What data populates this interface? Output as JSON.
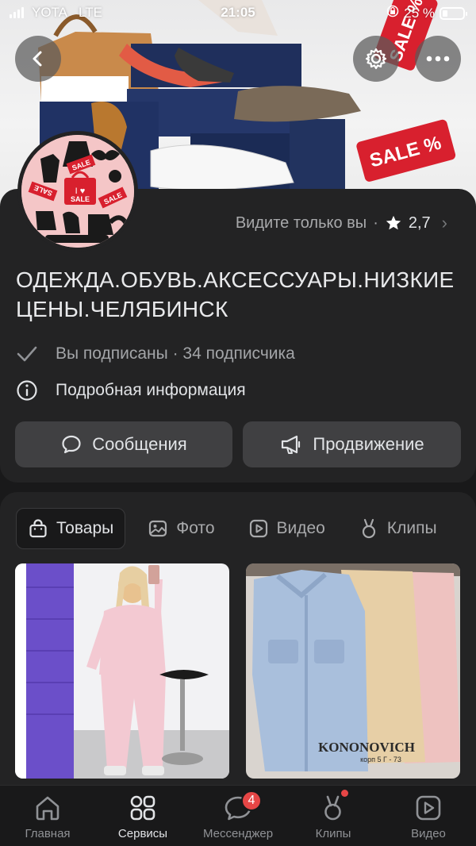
{
  "status_bar": {
    "carrier": "YOTA",
    "network": "LTE",
    "time": "21:05",
    "battery_percent": "25 %"
  },
  "header": {
    "visibility_text": "Видите только вы",
    "separator": "·",
    "rating": "2,7",
    "title": "ОДЕЖДА.ОБУВЬ.АКСЕССУАРЫ.НИЗКИЕ ЦЕНЫ.ЧЕЛЯБИНСК",
    "subscription_text": "Вы подписаны · 34 подписчика",
    "details_text": "Подробная информация"
  },
  "cover": {
    "sale_tag_1": "SALE %",
    "sale_tag_2": "SALE %"
  },
  "avatar": {
    "sale_top": "SALE",
    "sale_left": "SALE",
    "sale_right": "SALE",
    "sale_center": "SALE"
  },
  "actions": {
    "messages_label": "Сообщения",
    "promotion_label": "Продвижение"
  },
  "tabs": [
    {
      "label": "Товары",
      "icon": "shopping-bag-icon",
      "active": true
    },
    {
      "label": "Фото",
      "icon": "photo-icon",
      "active": false
    },
    {
      "label": "Видео",
      "icon": "video-icon",
      "active": false
    },
    {
      "label": "Клипы",
      "icon": "clips-icon",
      "active": false
    }
  ],
  "products": [
    {
      "caption": ""
    },
    {
      "caption": "KONONOVICH",
      "subcaption": "корп 5 Г - 73"
    }
  ],
  "bottom_nav": [
    {
      "label": "Главная",
      "icon": "home-icon",
      "active": false
    },
    {
      "label": "Сервисы",
      "icon": "services-icon",
      "active": true
    },
    {
      "label": "Мессенджер",
      "icon": "messenger-icon",
      "active": false,
      "badge": "4"
    },
    {
      "label": "Клипы",
      "icon": "clips-icon",
      "active": false,
      "dot": true
    },
    {
      "label": "Видео",
      "icon": "video-icon",
      "active": false
    }
  ],
  "colors": {
    "background": "#19191a",
    "card": "#232324",
    "button": "#404042",
    "badge": "#e64646",
    "sale_red": "#d8202e"
  }
}
